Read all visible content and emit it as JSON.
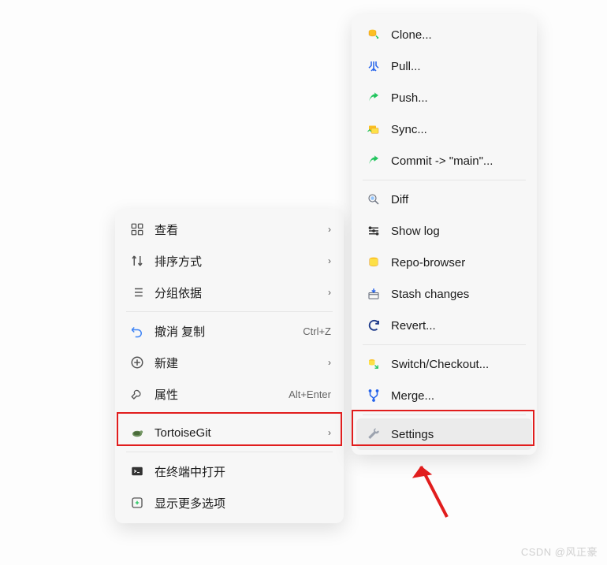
{
  "left_menu": {
    "groups": [
      [
        {
          "icon": "grid",
          "label": "查看"
        },
        {
          "icon": "sort",
          "label": "排序方式"
        },
        {
          "icon": "group",
          "label": "分组依据"
        }
      ],
      [
        {
          "icon": "undo",
          "label": "撤消 复制",
          "hint": "Ctrl+Z"
        },
        {
          "icon": "plus",
          "label": "新建"
        },
        {
          "icon": "wrench-outline",
          "label": "属性",
          "hint": "Alt+Enter"
        }
      ],
      [
        {
          "icon": "tortoise",
          "label": "TortoiseGit",
          "highlight": true
        }
      ],
      [
        {
          "icon": "terminal",
          "label": "在终端中打开"
        },
        {
          "icon": "more",
          "label": "显示更多选项"
        }
      ]
    ]
  },
  "right_menu": {
    "groups": [
      [
        {
          "icon": "clone",
          "label": "Clone..."
        },
        {
          "icon": "pull",
          "label": "Pull..."
        },
        {
          "icon": "push",
          "label": "Push..."
        },
        {
          "icon": "sync",
          "label": "Sync..."
        },
        {
          "icon": "commit",
          "label": "Commit -> \"main\"..."
        }
      ],
      [
        {
          "icon": "diff",
          "label": "Diff"
        },
        {
          "icon": "log",
          "label": "Show log"
        },
        {
          "icon": "repo",
          "label": "Repo-browser"
        },
        {
          "icon": "stash",
          "label": "Stash changes"
        },
        {
          "icon": "revert",
          "label": "Revert..."
        }
      ],
      [
        {
          "icon": "switch",
          "label": "Switch/Checkout..."
        },
        {
          "icon": "merge",
          "label": "Merge..."
        }
      ],
      [
        {
          "icon": "wrench",
          "label": "Settings",
          "highlight": true,
          "hover": true
        }
      ]
    ]
  },
  "watermark": "CSDN @风正豪"
}
